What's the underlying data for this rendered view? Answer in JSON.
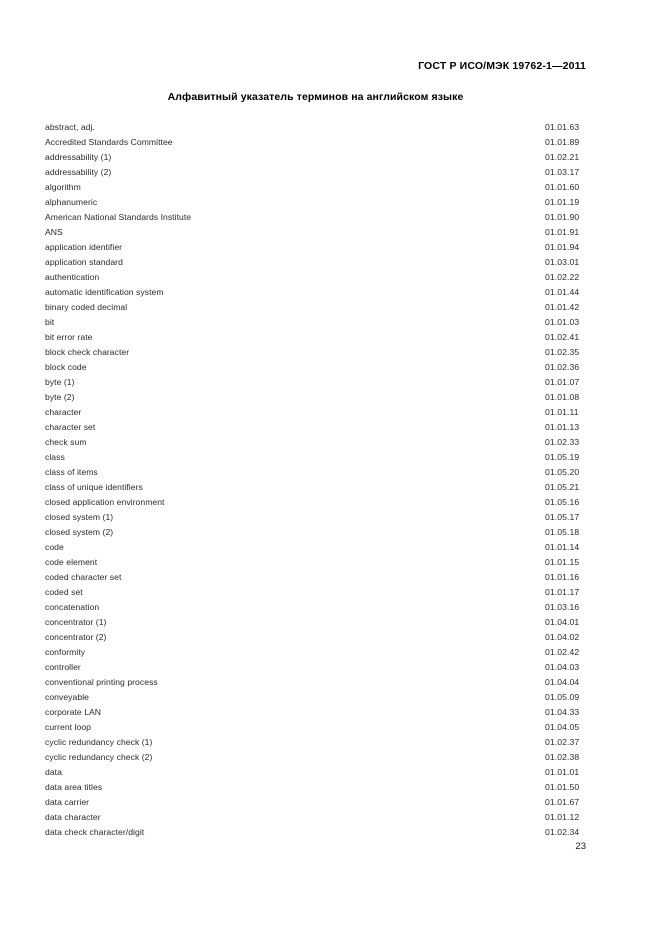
{
  "header": {
    "standard_reference": "ГОСТ Р ИСО/МЭК 19762-1—2011"
  },
  "title": "Алфавитный указатель терминов на английском языке",
  "footer": {
    "page_number": "23"
  },
  "index": {
    "entries": [
      {
        "term": "abstract, adj.",
        "code": "01.01.63"
      },
      {
        "term": "Accredited Standards Committee",
        "code": "01.01.89"
      },
      {
        "term": "addressability (1)",
        "code": "01.02.21"
      },
      {
        "term": "addressability (2)",
        "code": "01.03.17"
      },
      {
        "term": "algorithm",
        "code": "01.01.60"
      },
      {
        "term": "alphanumeric",
        "code": "01.01.19"
      },
      {
        "term": "American National Standards Institute",
        "code": "01.01.90"
      },
      {
        "term": "ANS",
        "code": "01.01.91"
      },
      {
        "term": "application identifier",
        "code": "01.01.94"
      },
      {
        "term": "application standard",
        "code": "01.03.01"
      },
      {
        "term": "authentication",
        "code": "01.02.22"
      },
      {
        "term": "automatic identification system",
        "code": "01.01.44"
      },
      {
        "term": "binary coded decimal",
        "code": "01.01.42"
      },
      {
        "term": "bit",
        "code": "01.01.03"
      },
      {
        "term": "bit error rate",
        "code": "01.02.41"
      },
      {
        "term": "block check character",
        "code": "01.02.35"
      },
      {
        "term": "block code",
        "code": "01.02.36"
      },
      {
        "term": "byte (1)",
        "code": "01.01.07"
      },
      {
        "term": "byte (2)",
        "code": "01.01.08"
      },
      {
        "term": "character",
        "code": "01.01.11"
      },
      {
        "term": "character set",
        "code": "01.01.13"
      },
      {
        "term": "check sum",
        "code": "01.02.33"
      },
      {
        "term": "class",
        "code": "01.05.19"
      },
      {
        "term": "class of items",
        "code": "01.05.20"
      },
      {
        "term": "class of unique identifiers",
        "code": "01.05.21"
      },
      {
        "term": "closed application environment",
        "code": "01.05.16"
      },
      {
        "term": "closed system (1)",
        "code": "01.05.17"
      },
      {
        "term": "closed system (2)",
        "code": "01.05.18"
      },
      {
        "term": "code",
        "code": "01.01.14"
      },
      {
        "term": "code element",
        "code": "01.01.15"
      },
      {
        "term": "coded character set",
        "code": "01.01.16"
      },
      {
        "term": "coded set",
        "code": "01.01.17"
      },
      {
        "term": "concatenation",
        "code": "01.03.16"
      },
      {
        "term": "concentrator (1)",
        "code": "01.04.01"
      },
      {
        "term": "concentrator (2)",
        "code": "01.04.02"
      },
      {
        "term": "conformity",
        "code": "01.02.42"
      },
      {
        "term": "controller",
        "code": "01.04.03"
      },
      {
        "term": "conventional printing process",
        "code": "01.04.04"
      },
      {
        "term": "conveyable",
        "code": "01.05.09"
      },
      {
        "term": "corporate LAN",
        "code": "01.04.33"
      },
      {
        "term": "current loop",
        "code": "01.04.05"
      },
      {
        "term": "cyclic redundancy check (1)",
        "code": "01.02.37"
      },
      {
        "term": "cyclic redundancy check (2)",
        "code": "01.02.38"
      },
      {
        "term": "data",
        "code": "01.01.01"
      },
      {
        "term": "data area titles",
        "code": "01.01.50"
      },
      {
        "term": "data carrier",
        "code": "01.01.67"
      },
      {
        "term": "data character",
        "code": "01.01.12"
      },
      {
        "term": "data check character/digit",
        "code": "01.02.34"
      }
    ]
  }
}
